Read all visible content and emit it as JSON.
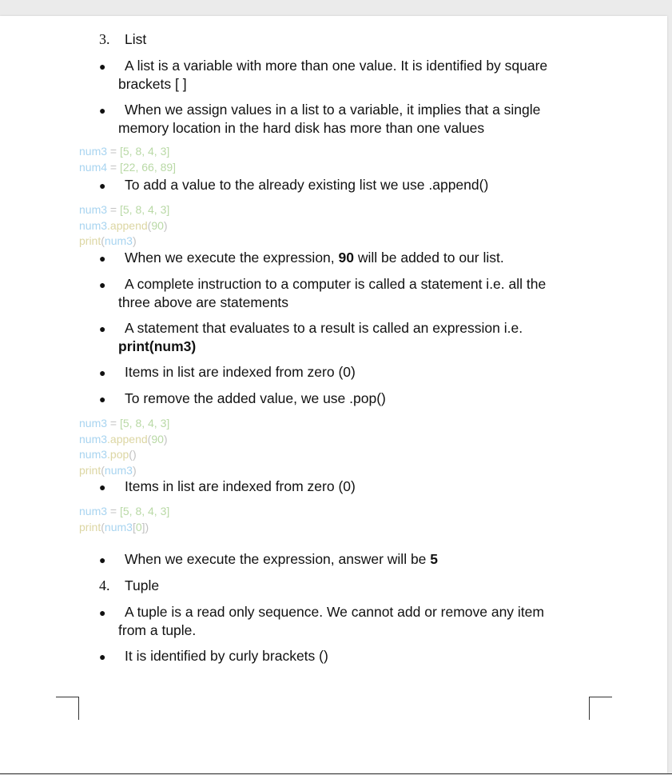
{
  "sections": [
    {
      "number": "3.",
      "title": "List"
    },
    {
      "number": "4.",
      "title": "Tuple"
    }
  ],
  "bullets": {
    "b1": {
      "line1": "A list is a variable with more than one value. It is identified by square",
      "line2": "brackets [ ]"
    },
    "b2": {
      "line1": "When we assign values in a list to a variable, it implies that a single",
      "line2": "memory location in the hard disk has more than one values"
    },
    "b3": {
      "text": "To add a value to the already existing list we use .append()"
    },
    "b4": {
      "before": "When we execute the expression, ",
      "bold": "90",
      "after": " will be added to our list."
    },
    "b5": {
      "line1": "A complete instruction to a computer is called a statement i.e. all the",
      "line2": "three above are statements"
    },
    "b6": {
      "line1": "A statement that evaluates to a result is called an expression i.e.",
      "line2": "print(num3)"
    },
    "b7": {
      "text": "Items in list are indexed from zero (0)"
    },
    "b8": {
      "text": "To remove the added value, we use .pop()"
    },
    "b9": {
      "text": "Items in list are indexed from zero (0)"
    },
    "b10": {
      "before": "When we execute the expression, answer will be ",
      "bold": "5"
    },
    "b11": {
      "line1": "A tuple is a read only sequence. We cannot add or remove any item",
      "line2": "from a tuple."
    },
    "b12": {
      "text": "It is identified by curly brackets ()"
    }
  },
  "bullet_char": "●",
  "code": {
    "block1": [
      {
        "var": "num3",
        "op": " = ",
        "val": "[5, 8, 4, 3]"
      },
      {
        "var": "num4",
        "op": " = ",
        "val": "[22, 66, 89]"
      }
    ],
    "block2": {
      "l1": {
        "var": "num3",
        "op": " = ",
        "val": "[5, 8, 4, 3]"
      },
      "l2": {
        "var": "num3",
        "fn": ".append",
        "open": "(",
        "val": "90",
        "close": ")"
      },
      "l3": {
        "fn": "print",
        "open": "(",
        "var": "num3",
        "close": ")"
      }
    },
    "block3": {
      "l1": {
        "var": "num3",
        "op": " = ",
        "val": "[5, 8, 4, 3]"
      },
      "l2": {
        "var": "num3",
        "fn": ".append",
        "open": "(",
        "val": "90",
        "close": ")"
      },
      "l3": {
        "var": "num3",
        "fn": ".pop",
        "call": "()"
      },
      "l4": {
        "fn": "print",
        "open": "(",
        "var": "num3",
        "close": ")"
      }
    },
    "block4": {
      "l1": {
        "var": "num3",
        "op": " = ",
        "val": "[5, 8, 4, 3]"
      },
      "l2": {
        "fn": "print",
        "open": "(",
        "var": "num3",
        "idx_open": "[",
        "val": "0",
        "idx_close": "]",
        "close": ")"
      }
    }
  },
  "colors": {
    "variable": "#a8d4f0",
    "value": "#b9d9a6",
    "operator": "#c2c2c2",
    "function": "#dcd6a3"
  }
}
